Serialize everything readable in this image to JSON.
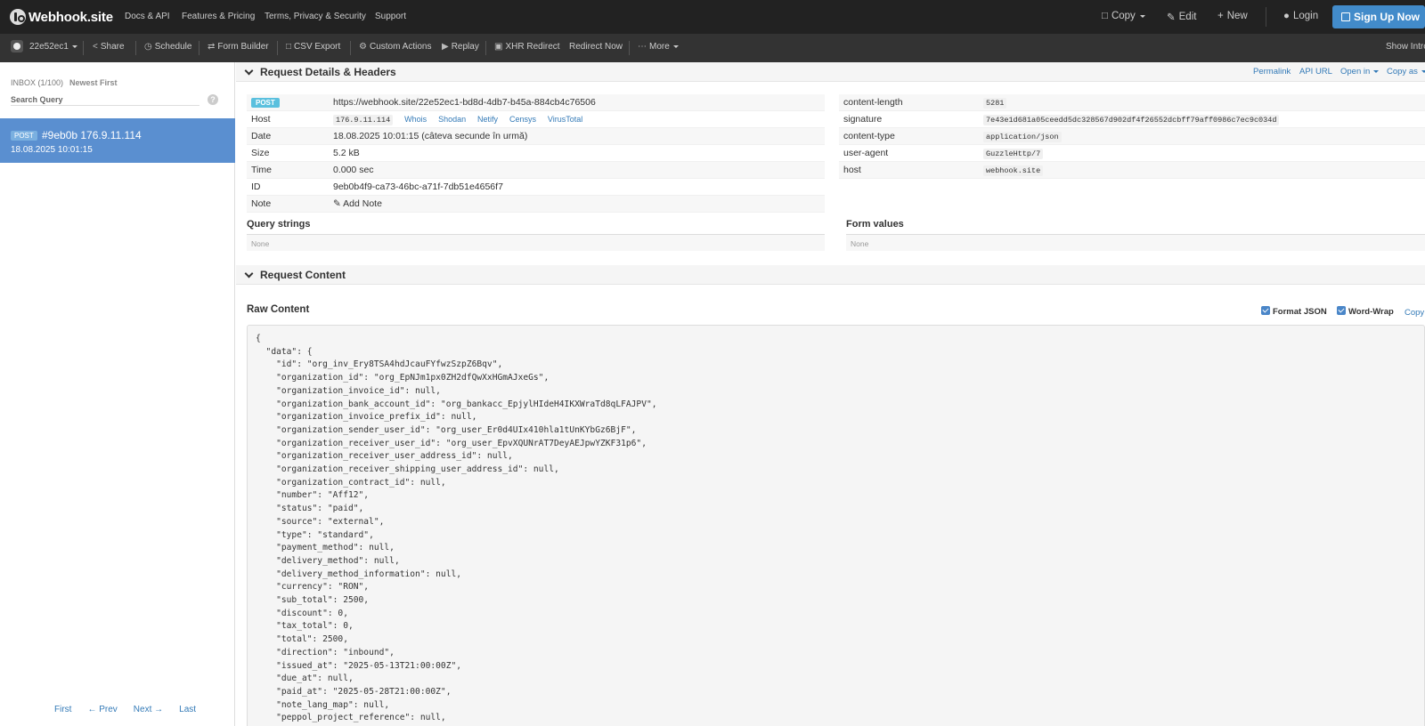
{
  "brand": {
    "name": "Webhook.site",
    "icon": "webhook-logo-icon"
  },
  "nav": [
    "Docs & API",
    "Features & Pricing",
    "Terms, Privacy & Security",
    "Support"
  ],
  "nav_right": {
    "copy": "Copy",
    "edit": "Edit",
    "new": "New",
    "login": "Login",
    "signup": "Sign Up Now"
  },
  "toolbar": {
    "token": "22e52ec1",
    "share": "Share",
    "schedule": "Schedule",
    "form_builder": "Form Builder",
    "csv_export": "CSV Export",
    "custom_actions": "Custom Actions",
    "replay": "Replay",
    "xhr_redirect": "XHR Redirect",
    "redirect_now": "Redirect Now",
    "more": "More",
    "show_intro": "Show Intro"
  },
  "sidebar": {
    "inbox": "INBOX (1/100)",
    "sort": "Newest First",
    "search_placeholder": "Search Query",
    "help": "?",
    "item": {
      "method": "POST",
      "title": "#9eb0b 176.9.11.114",
      "time": "18.08.2025 10:01:15"
    },
    "pager": {
      "first": "First",
      "prev": "← Prev",
      "next": "Next →",
      "last": "Last"
    }
  },
  "details": {
    "title": "Request Details & Headers",
    "links": {
      "permalink": "Permalink",
      "api_url": "API URL",
      "open_in": "Open in",
      "copy_as": "Copy as"
    },
    "method": "POST",
    "url": "https://webhook.site/22e52ec1-bd8d-4db7-b45a-884cb4c76506",
    "host_label": "Host",
    "host": "176.9.11.114",
    "host_links": [
      "Whois",
      "Shodan",
      "Netify",
      "Censys",
      "VirusTotal"
    ],
    "date_label": "Date",
    "date": "18.08.2025 10:01:15 (câteva secunde în urmă)",
    "size_label": "Size",
    "size": "5.2 kB",
    "time_label": "Time",
    "time": "0.000 sec",
    "id_label": "ID",
    "id": "9eb0b4f9-ca73-46bc-a71f-7db51e4656f7",
    "note_label": "Note",
    "note_action": "Add Note",
    "headers": [
      {
        "k": "content-length",
        "v": "5281"
      },
      {
        "k": "signature",
        "v": "7e43e1d681a05ceedd5dc328567d902df4f26552dcbff79aff0986c7ec9c034d"
      },
      {
        "k": "content-type",
        "v": "application/json"
      },
      {
        "k": "user-agent",
        "v": "GuzzleHttp/7"
      },
      {
        "k": "host",
        "v": "webhook.site"
      }
    ],
    "query_strings": "Query strings",
    "query_none": "None",
    "form_values": "Form values",
    "form_none": "None"
  },
  "content": {
    "title": "Request Content",
    "raw_title": "Raw Content",
    "format_json": "Format JSON",
    "word_wrap": "Word-Wrap",
    "copy": "Copy",
    "raw": "{\n  \"data\": {\n    \"id\": \"org_inv_Ery8TSA4hdJcauFYfwzSzpZ6Bqv\",\n    \"organization_id\": \"org_EpNJm1px0ZH2dfQwXxHGmAJxeGs\",\n    \"organization_invoice_id\": null,\n    \"organization_bank_account_id\": \"org_bankacc_EpjylHIdeH4IKXWraTd8qLFAJPV\",\n    \"organization_invoice_prefix_id\": null,\n    \"organization_sender_user_id\": \"org_user_Er0d4UIx410hla1tUnKYbGz6BjF\",\n    \"organization_receiver_user_id\": \"org_user_EpvXQUNrAT7DeyAEJpwYZKF31p6\",\n    \"organization_receiver_user_address_id\": null,\n    \"organization_receiver_shipping_user_address_id\": null,\n    \"organization_contract_id\": null,\n    \"number\": \"Aff12\",\n    \"status\": \"paid\",\n    \"source\": \"external\",\n    \"type\": \"standard\",\n    \"payment_method\": null,\n    \"delivery_method\": null,\n    \"delivery_method_information\": null,\n    \"currency\": \"RON\",\n    \"sub_total\": 2500,\n    \"discount\": 0,\n    \"tax_total\": 0,\n    \"total\": 2500,\n    \"direction\": \"inbound\",\n    \"issued_at\": \"2025-05-13T21:00:00Z\",\n    \"due_at\": null,\n    \"paid_at\": \"2025-05-28T21:00:00Z\",\n    \"note_lang_map\": null,\n    \"peppol_project_reference\": null,"
  }
}
